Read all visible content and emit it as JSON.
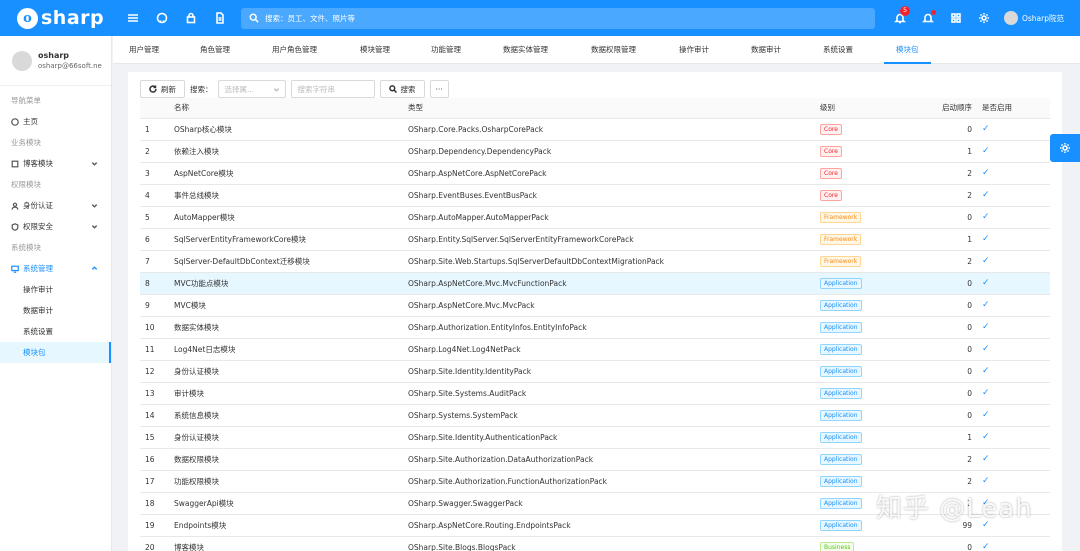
{
  "app": {
    "logo_letter": "o",
    "logo_text": "sharp"
  },
  "header": {
    "search_placeholder": "搜索：员工、文件、照片等",
    "notification_count": "5",
    "user_name": "Osharp院范"
  },
  "sidebar": {
    "profile": {
      "name": "osharp",
      "email": "osharp@66soft.ne"
    },
    "nav_group": "导航菜单",
    "home": "主页",
    "business_group": "业务模块",
    "blog": "博客模块",
    "permission_group": "权限模块",
    "auth": "身份认证",
    "security": "权限安全",
    "system_group": "系统模块",
    "system_mgmt": "系统管理",
    "sub_items": [
      "操作审计",
      "数据审计",
      "系统设置",
      "模块包"
    ]
  },
  "tabs": [
    "用户管理",
    "角色管理",
    "用户角色管理",
    "模块管理",
    "功能管理",
    "数据实体管理",
    "数据权限管理",
    "操作审计",
    "数据审计",
    "系统设置",
    "模块包"
  ],
  "toolbar": {
    "refresh": "刷新",
    "search_label": "搜索：",
    "select_placeholder": "选择属...",
    "input_placeholder": "搜索字符串",
    "search_button": "搜索",
    "more": "···"
  },
  "table": {
    "headers": [
      "",
      "名称",
      "类型",
      "级别",
      "启动顺序",
      "是否启用"
    ],
    "rows": [
      {
        "no": "1",
        "name": "OSharp核心模块",
        "type": "OSharp.Core.Packs.OsharpCorePack",
        "level": "Core",
        "order": "0"
      },
      {
        "no": "2",
        "name": "依赖注入模块",
        "type": "OSharp.Dependency.DependencyPack",
        "level": "Core",
        "order": "1"
      },
      {
        "no": "3",
        "name": "AspNetCore模块",
        "type": "OSharp.AspNetCore.AspNetCorePack",
        "level": "Core",
        "order": "2"
      },
      {
        "no": "4",
        "name": "事件总线模块",
        "type": "OSharp.EventBuses.EventBusPack",
        "level": "Core",
        "order": "2"
      },
      {
        "no": "5",
        "name": "AutoMapper模块",
        "type": "OSharp.AutoMapper.AutoMapperPack",
        "level": "Framework",
        "order": "0"
      },
      {
        "no": "6",
        "name": "SqlServerEntityFrameworkCore模块",
        "type": "OSharp.Entity.SqlServer.SqlServerEntityFrameworkCorePack",
        "level": "Framework",
        "order": "1"
      },
      {
        "no": "7",
        "name": "SqlServer-DefaultDbContext迁移模块",
        "type": "OSharp.Site.Web.Startups.SqlServerDefaultDbContextMigrationPack",
        "level": "Framework",
        "order": "2"
      },
      {
        "no": "8",
        "name": "MVC功能点模块",
        "type": "OSharp.AspNetCore.Mvc.MvcFunctionPack",
        "level": "Application",
        "order": "0"
      },
      {
        "no": "9",
        "name": "MVC模块",
        "type": "OSharp.AspNetCore.Mvc.MvcPack",
        "level": "Application",
        "order": "0"
      },
      {
        "no": "10",
        "name": "数据实体模块",
        "type": "OSharp.Authorization.EntityInfos.EntityInfoPack",
        "level": "Application",
        "order": "0"
      },
      {
        "no": "11",
        "name": "Log4Net日志模块",
        "type": "OSharp.Log4Net.Log4NetPack",
        "level": "Application",
        "order": "0"
      },
      {
        "no": "12",
        "name": "身份认证模块",
        "type": "OSharp.Site.Identity.IdentityPack",
        "level": "Application",
        "order": "0"
      },
      {
        "no": "13",
        "name": "审计模块",
        "type": "OSharp.Site.Systems.AuditPack",
        "level": "Application",
        "order": "0"
      },
      {
        "no": "14",
        "name": "系统信息模块",
        "type": "OSharp.Systems.SystemPack",
        "level": "Application",
        "order": "0"
      },
      {
        "no": "15",
        "name": "身份认证模块",
        "type": "OSharp.Site.Identity.AuthenticationPack",
        "level": "Application",
        "order": "1"
      },
      {
        "no": "16",
        "name": "数据权限模块",
        "type": "OSharp.Site.Authorization.DataAuthorizationPack",
        "level": "Application",
        "order": "2"
      },
      {
        "no": "17",
        "name": "功能权限模块",
        "type": "OSharp.Site.Authorization.FunctionAuthorizationPack",
        "level": "Application",
        "order": "2"
      },
      {
        "no": "18",
        "name": "SwaggerApi模块",
        "type": "OSharp.Swagger.SwaggerPack",
        "level": "Application",
        "order": "2"
      },
      {
        "no": "19",
        "name": "Endpoints模块",
        "type": "OSharp.AspNetCore.Routing.EndpointsPack",
        "level": "Application",
        "order": "99"
      },
      {
        "no": "20",
        "name": "博客模块",
        "type": "OSharp.Site.Blogs.BlogsPack",
        "level": "Business",
        "order": "0"
      }
    ],
    "enabled_mark": "✓"
  },
  "watermark": "知乎 @Leah",
  "colors": {
    "primary": "#1890ff",
    "core": "#f5222d",
    "framework": "#fa8c16",
    "application": "#1890ff",
    "business": "#52c41a"
  }
}
